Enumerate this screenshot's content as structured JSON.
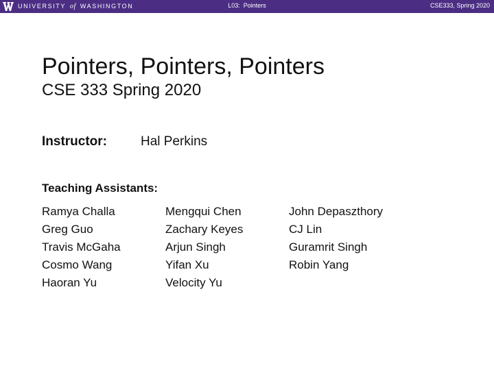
{
  "header": {
    "logo_text_left": "UNIVERSITY",
    "logo_text_of": "of",
    "logo_text_right": "WASHINGTON",
    "lecture": "L03:  Pointers",
    "course": "CSE333, Spring 2020",
    "bar_color": "#4b2e83"
  },
  "slide": {
    "title": "Pointers, Pointers, Pointers",
    "subtitle": "CSE 333 Spring 2020",
    "instructor_label": "Instructor:",
    "instructor_name": "Hal Perkins",
    "ta_label": "Teaching Assistants:",
    "ta_columns": [
      [
        "Ramya Challa",
        "Greg Guo",
        "Travis McGaha",
        "Cosmo Wang",
        "Haoran Yu"
      ],
      [
        "Mengqui Chen",
        "Zachary Keyes",
        "Arjun Singh",
        "Yifan Xu",
        "Velocity Yu"
      ],
      [
        "John Depaszthory",
        "CJ Lin",
        "Guramrit Singh",
        "Robin Yang"
      ]
    ]
  },
  "icons": {
    "logo": "uw-w-logo-icon"
  }
}
